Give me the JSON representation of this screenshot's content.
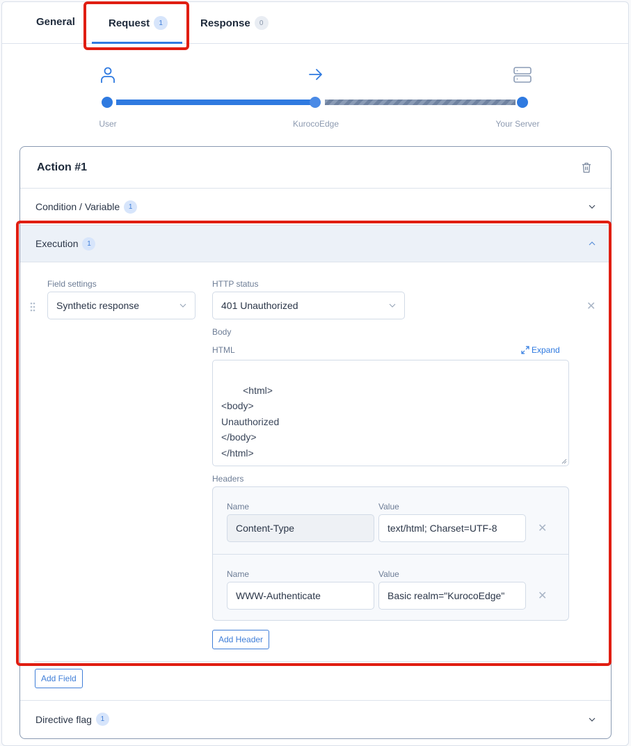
{
  "tabs": [
    {
      "label": "General",
      "badge": null
    },
    {
      "label": "Request",
      "badge": "1",
      "active": true
    },
    {
      "label": "Response",
      "badge": "0"
    }
  ],
  "flow": {
    "nodes": [
      {
        "label": "User",
        "icon": "user-icon"
      },
      {
        "label": "KurocoEdge",
        "icon": "arrow-right-icon"
      },
      {
        "label": "Your Server",
        "icon": "server-icon"
      }
    ]
  },
  "action": {
    "title": "Action #1",
    "sections": {
      "condition": {
        "label": "Condition / Variable",
        "badge": "1"
      },
      "execution": {
        "label": "Execution",
        "badge": "1"
      },
      "directive": {
        "label": "Directive flag",
        "badge": "1"
      }
    },
    "field": {
      "field_settings_label": "Field settings",
      "field_settings_value": "Synthetic response",
      "http_status_label": "HTTP status",
      "http_status_value": "401 Unauthorized",
      "body_label": "Body",
      "html_label": "HTML",
      "expand_label": "Expand",
      "html_value": "<html>\n<body>\nUnauthorized\n</body>\n</html>",
      "headers_label": "Headers",
      "headers": [
        {
          "name_label": "Name",
          "value_label": "Value",
          "name": "Content-Type",
          "value": "text/html; Charset=UTF-8"
        },
        {
          "name_label": "Name",
          "value_label": "Value",
          "name": "WWW-Authenticate",
          "value": "Basic realm=\"KurocoEdge\""
        }
      ],
      "add_header_label": "Add Header"
    },
    "add_field_label": "Add Field"
  },
  "colors": {
    "accent": "#2f7ae0",
    "highlight": "#e01e12"
  }
}
